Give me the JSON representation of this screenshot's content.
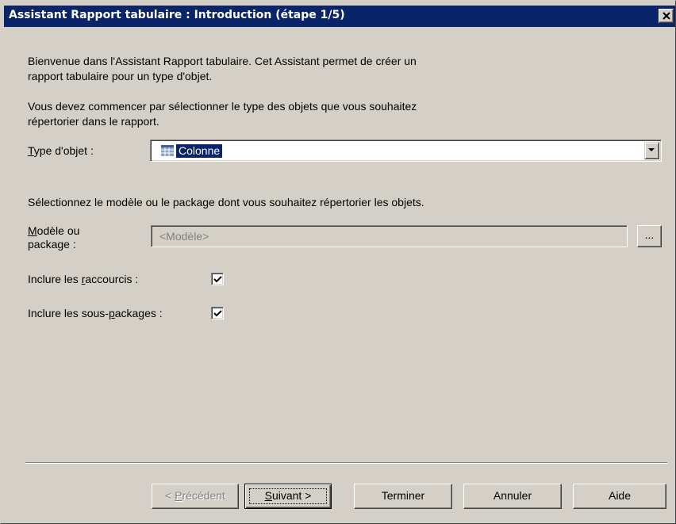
{
  "window": {
    "title": "Assistant Rapport tabulaire : Introduction (étape 1/5)",
    "close_glyph": "✕"
  },
  "intro": {
    "line1": "Bienvenue dans l'Assistant Rapport tabulaire. Cet Assistant permet de créer un",
    "line2": "rapport tabulaire pour un type d'objet.",
    "line3": "Vous devez commencer par sélectionner le type des objets que vous souhaitez",
    "line4": "répertorier dans le rapport."
  },
  "type_field": {
    "label_prefix": "",
    "label_access": "T",
    "label_rest": "ype d'objet :",
    "value": "Colonne",
    "icon": "column-icon"
  },
  "model_section": {
    "instruction": "Sélectionnez le modèle ou le package dont vous souhaitez répertorier les objets.",
    "label_access": "M",
    "label_rest_line1": "odèle ou",
    "label_line2": "package :",
    "placeholder": "<Modèle>",
    "browse_label": "..."
  },
  "options": {
    "shortcuts_prefix": "Inclure les ",
    "shortcuts_access": "r",
    "shortcuts_rest": "accourcis :",
    "shortcuts_checked": true,
    "subpackages_prefix": "Inclure les sous-",
    "subpackages_access": "p",
    "subpackages_rest": "ackages :",
    "subpackages_checked": true
  },
  "buttons": {
    "previous_prefix": "< ",
    "previous_access": "P",
    "previous_rest": "récédent",
    "next_access": "S",
    "next_rest": "uivant >",
    "finish": "Terminer",
    "cancel": "Annuler",
    "help": "Aide"
  },
  "colors": {
    "titlebar": "#0a246a",
    "face": "#d4d0c8",
    "selection": "#0a246a"
  }
}
